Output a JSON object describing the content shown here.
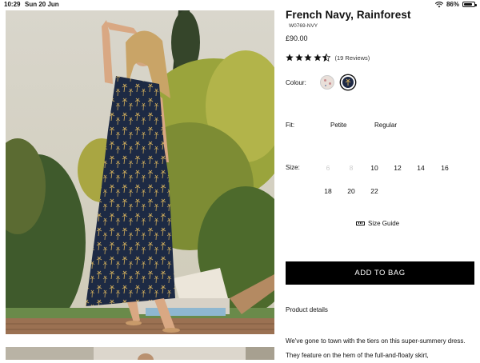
{
  "status_bar": {
    "time": "10:29",
    "date": "Sun 20 Jun",
    "battery": "86%",
    "battery_level": 0.86
  },
  "product": {
    "title": "French Navy, Rainforest",
    "sku": "W0769-NVY",
    "price": "£90.00",
    "rating": 4.5,
    "reviews": "(19 Reviews)"
  },
  "colour": {
    "label": "Colour:",
    "swatches": [
      "pink-floral",
      "navy-palm"
    ],
    "selected": "navy-palm"
  },
  "fit": {
    "label": "Fit:",
    "options": [
      "Petite",
      "Regular"
    ]
  },
  "size": {
    "label": "Size:",
    "options": [
      {
        "value": "6",
        "available": false
      },
      {
        "value": "8",
        "available": false
      },
      {
        "value": "10",
        "available": true
      },
      {
        "value": "12",
        "available": true
      },
      {
        "value": "14",
        "available": true
      },
      {
        "value": "16",
        "available": true
      },
      {
        "value": "18",
        "available": true
      },
      {
        "value": "20",
        "available": true
      },
      {
        "value": "22",
        "available": true
      }
    ],
    "guide_label": "Size Guide"
  },
  "actions": {
    "add_to_bag": "ADD TO BAG"
  },
  "details": {
    "link_label": "Product details",
    "description": "We've gone to town with the tiers on this super-summery dress. They feature on the hem of the full-and-floaty skirt,"
  },
  "colors": {
    "accent": "#000000",
    "navy": "#1e2945",
    "star": "#111111"
  }
}
